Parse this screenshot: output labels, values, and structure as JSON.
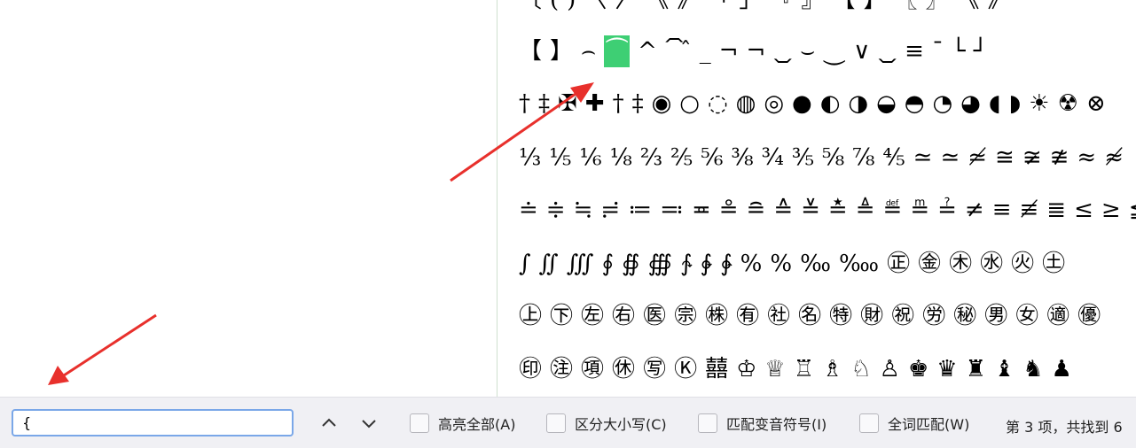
{
  "glyph_rows": [
    [
      "〔",
      "(",
      ")",
      "〈",
      "〉",
      "《",
      "》",
      "「",
      "」",
      "『",
      "』",
      "【",
      "】",
      "〖",
      "〗",
      "《",
      "》"
    ],
    [
      "【",
      "】",
      "⌢",
      "⏜",
      "^",
      "⏠",
      "̂",
      "_",
      "¬",
      "¬",
      "⏡",
      "⌣",
      "⏝",
      "∨",
      "⏡",
      "≡",
      "ˉ",
      "└",
      "┘"
    ],
    [
      "†",
      "‡",
      "✠",
      "✚",
      "†",
      "‡",
      "◉",
      "○",
      "◌",
      "◍",
      "◎",
      "●",
      "◐",
      "◑",
      "◒",
      "◓",
      "◔",
      "◕",
      "◖",
      "◗",
      "☀",
      "☢",
      "⊗"
    ],
    [
      "⅓",
      "⅕",
      "⅙",
      "⅛",
      "⅔",
      "⅖",
      "⅚",
      "⅜",
      "¾",
      "⅗",
      "⅝",
      "⅞",
      "⅘",
      "≃",
      "≃",
      "≄",
      "≅",
      "≆",
      "≇",
      "≈",
      "≉"
    ],
    [
      "≐",
      "≑",
      "≒",
      "≓",
      "≔",
      "≕",
      "≖",
      "≗",
      "≘",
      "≙",
      "≚",
      "≛",
      "≜",
      "≝",
      "≞",
      "≟",
      "≠",
      "≡",
      "≢",
      "≣",
      "≤",
      "≥",
      "≦"
    ],
    [
      "∫",
      "∬",
      "∭",
      "∮",
      "∯",
      "∰",
      "∱",
      "∲",
      "∳",
      "%",
      "%",
      "‰",
      "‱",
      "㊣",
      "㊎",
      "㊍",
      "㊌",
      "㊋",
      "㊏"
    ],
    [
      "㊤",
      "㊦",
      "㊧",
      "㊨",
      "㊩",
      "㊪",
      "㊑",
      "㊒",
      "㊓",
      "㊔",
      "㊕",
      "㊖",
      "㊗",
      "㊘",
      "㊙",
      "㊚",
      "㊛",
      "㊜",
      "㊝"
    ],
    [
      "㊞",
      "㊟",
      "㊠",
      "㊡",
      "㊢",
      "Ⓚ",
      "囍",
      "♔",
      "♕",
      "♖",
      "♗",
      "♘",
      "♙",
      "♚",
      "♛",
      "♜",
      "♝",
      "♞",
      "♟"
    ]
  ],
  "highlight_glyph": "⏜",
  "find_bar": {
    "input_value": "{",
    "options": [
      "高亮全部(A)",
      "区分大小写(C)",
      "匹配变音符号(I)",
      "全词匹配(W)"
    ],
    "status": "第 3 项，共找到 6"
  },
  "colors": {
    "highlight": "#3ecf74",
    "arrow": "#e8302c",
    "find_bar_bg": "#f0f0f4",
    "input_border": "#7aa7e8"
  }
}
